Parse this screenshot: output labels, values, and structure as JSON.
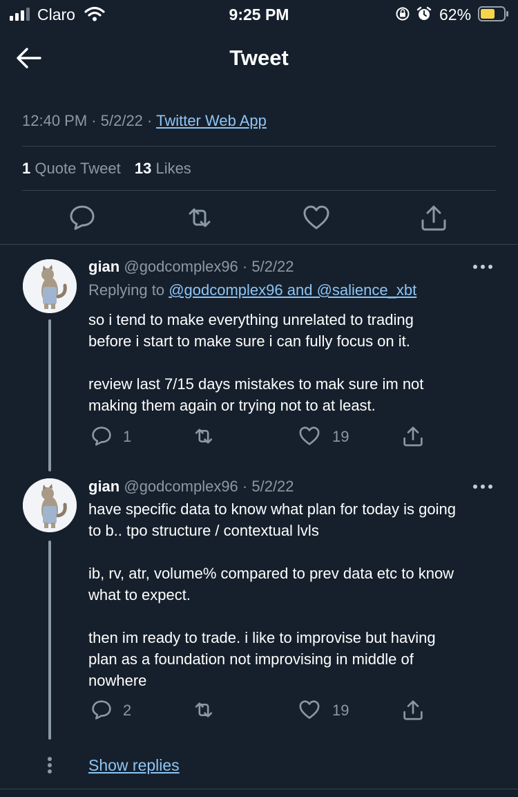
{
  "status_bar": {
    "carrier": "Claro",
    "time": "9:25 PM",
    "battery": "62%"
  },
  "header": {
    "title": "Tweet"
  },
  "tweet": {
    "time": "12:40 PM",
    "date": "5/2/22",
    "source": "Twitter Web App",
    "quote_count": "1",
    "quote_label": "Quote Tweet",
    "likes_count": "13",
    "likes_label": "Likes"
  },
  "replies": [
    {
      "name": "gian",
      "handle": "@godcomplex96",
      "date": "· 5/2/22",
      "replying_prefix": "Replying to",
      "replying_to": "@godcomplex96 and @salience_xbt",
      "paragraphs": [
        [
          "so i tend to make everything unrelated to trading",
          "before i start to make sure i can fully focus on it."
        ],
        [
          "review last 7/15 days mistakes to mak sure im not",
          "making them again or trying not to at least."
        ]
      ],
      "reply_count": "1",
      "like_count": "19"
    },
    {
      "name": "gian",
      "handle": "@godcomplex96",
      "date": "· 5/2/22",
      "paragraphs": [
        [
          "have specific data to know what plan for today is going",
          "to b.. tpo structure / contextual lvls"
        ],
        [
          "ib, rv, atr, volume% compared to prev data etc to know",
          "what to expect."
        ],
        [
          "then im ready to trade. i like to improvise but having",
          "plan as a foundation not improvising in middle of",
          "nowhere"
        ]
      ],
      "reply_count": "2",
      "like_count": "19"
    }
  ],
  "show_replies": "Show replies",
  "colors": {
    "background": "#16202c",
    "secondary_text": "#8b98a5",
    "link": "#8ec5f5",
    "divider": "#38444d",
    "battery": "#f7d54a"
  }
}
